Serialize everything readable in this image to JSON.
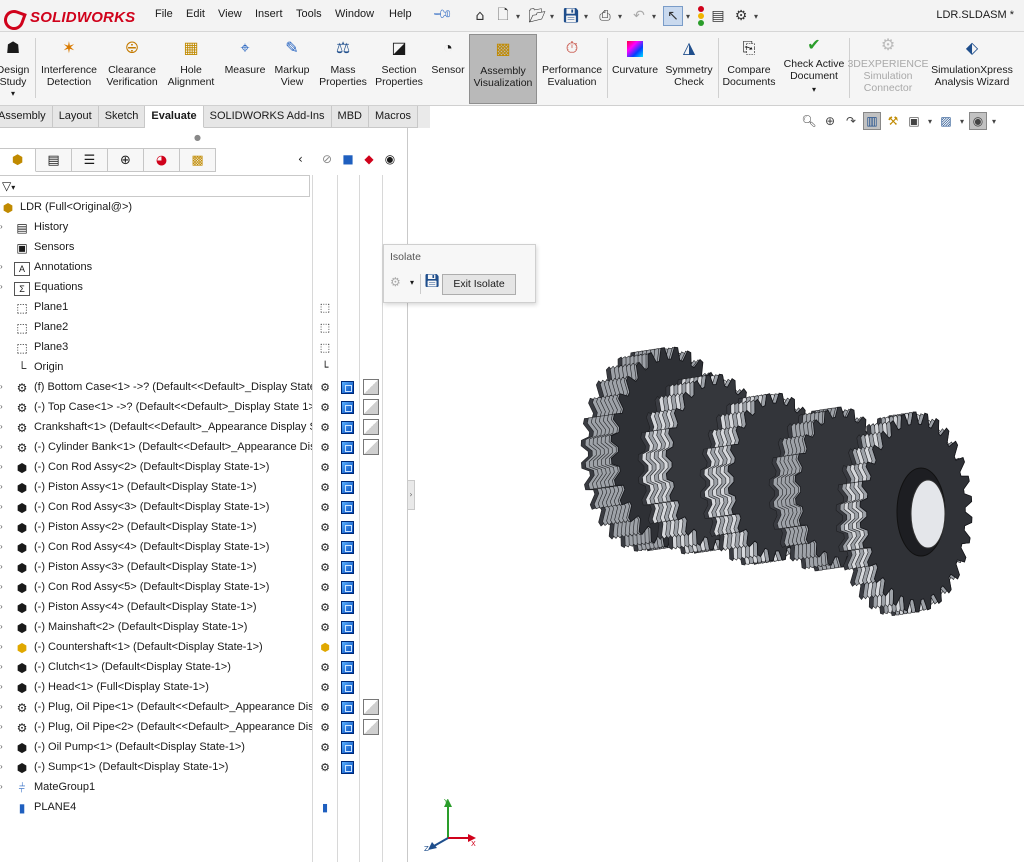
{
  "app": {
    "brand": "SOLIDWORKS",
    "document_title": "LDR.SLDASM *"
  },
  "menu": [
    "File",
    "Edit",
    "View",
    "Insert",
    "Tools",
    "Window",
    "Help"
  ],
  "quick_access": [
    "home-icon",
    "new-document-icon",
    "open-folder-icon",
    "save-icon",
    "print-icon",
    "undo-icon",
    "select-cursor-icon",
    "rebuild-icon",
    "file-properties-icon",
    "options-icon"
  ],
  "ribbon": [
    {
      "label": "Design\nStudy",
      "icon": "design-study-icon"
    },
    {
      "label": "Interference\nDetection",
      "icon": "interference-detection-icon"
    },
    {
      "label": "Clearance\nVerification",
      "icon": "clearance-verification-icon"
    },
    {
      "label": "Hole\nAlignment",
      "icon": "hole-alignment-icon"
    },
    {
      "label": "Measure",
      "icon": "measure-icon"
    },
    {
      "label": "Markup\nView",
      "icon": "markup-icon"
    },
    {
      "label": "Mass\nProperties",
      "icon": "mass-properties-icon"
    },
    {
      "label": "Section\nProperties",
      "icon": "section-properties-icon"
    },
    {
      "label": "Sensor",
      "icon": "sensor-icon"
    },
    {
      "label": "Assembly\nVisualization",
      "icon": "assembly-visualization-icon",
      "active": true
    },
    {
      "label": "Performance\nEvaluation",
      "icon": "performance-evaluation-icon"
    },
    {
      "label": "Curvature",
      "icon": "curvature-icon"
    },
    {
      "label": "Symmetry\nCheck",
      "icon": "symmetry-check-icon"
    },
    {
      "label": "Compare\nDocuments",
      "icon": "compare-documents-icon"
    },
    {
      "label": "Check Active\nDocument",
      "icon": "check-document-icon"
    },
    {
      "label": "3DEXPERIENCE\nSimulation\nConnector",
      "icon": "3dexperience-icon",
      "disabled": true
    },
    {
      "label": "SimulationXpress\nAnalysis Wizard",
      "icon": "simulationxpress-icon"
    }
  ],
  "command_tabs": [
    "Assembly",
    "Layout",
    "Sketch",
    "Evaluate",
    "SOLIDWORKS Add-Ins",
    "MBD",
    "Macros"
  ],
  "active_command_tab": "Evaluate",
  "tree": {
    "root": "LDR  (Full<Original@>)",
    "folders": [
      "History",
      "Sensors",
      "Annotations",
      "Equations",
      "Plane1",
      "Plane2",
      "Plane3",
      "Origin"
    ],
    "components": [
      "(f) Bottom Case<1> ->? (Default<<Default>_Display State",
      "(-) Top Case<1> ->? (Default<<Default>_Display State 1>)",
      "Crankshaft<1> (Default<<Default>_Appearance Display St",
      "(-) Cylinder Bank<1> (Default<<Default>_Appearance Dis",
      "(-) Con Rod Assy<2> (Default<Display State-1>)",
      "(-) Piston Assy<1> (Default<Display State-1>)",
      "(-) Con Rod Assy<3> (Default<Display State-1>)",
      "(-) Piston Assy<2> (Default<Display State-1>)",
      "(-) Con Rod Assy<4> (Default<Display State-1>)",
      "(-) Piston Assy<3> (Default<Display State-1>)",
      "(-) Con Rod Assy<5> (Default<Display State-1>)",
      "(-) Piston Assy<4> (Default<Display State-1>)",
      "(-) Mainshaft<2> (Default<Display State-1>)",
      "(-) Countershaft<1> (Default<Display State-1>)",
      "(-) Clutch<1> (Default<Display State-1>)",
      "(-) Head<1> (Full<Display State-1>)",
      "(-) Plug, Oil Pipe<1> (Default<<Default>_Appearance Disp",
      "(-) Plug, Oil Pipe<2> (Default<<Default>_Appearance Disp",
      "(-) Oil Pump<1> (Default<Display State-1>)",
      "(-) Sump<1> (Default<Display State-1>)"
    ],
    "tail": [
      "MateGroup1",
      "PLANE4"
    ]
  },
  "isolate_popup": {
    "title": "Isolate",
    "exit_label": "Exit Isolate"
  },
  "colors": {
    "brand_red": "#d0021b",
    "accent_blue": "#0046b8"
  }
}
